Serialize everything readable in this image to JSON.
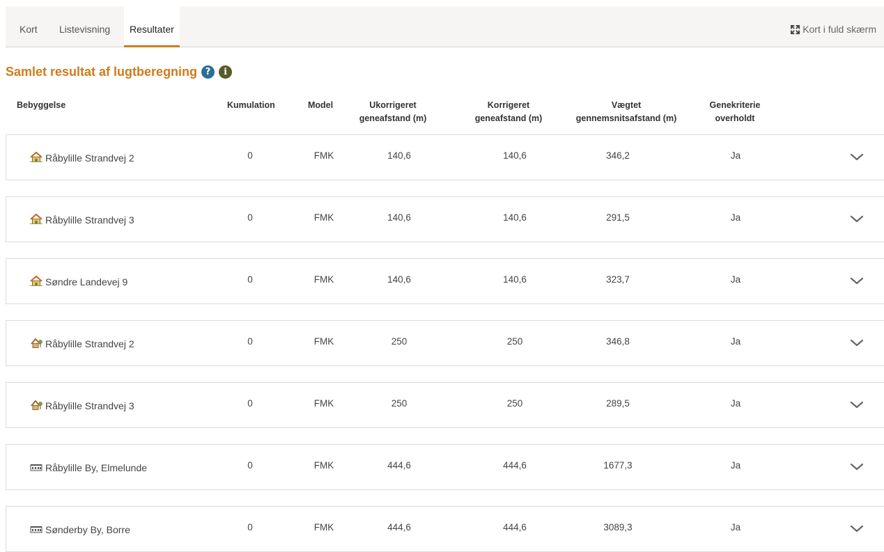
{
  "tabs": [
    {
      "label": "Kort",
      "active": false
    },
    {
      "label": "Listevisning",
      "active": false
    },
    {
      "label": "Resultater",
      "active": true
    }
  ],
  "fullscreen_label": "Kort i fuld skærm",
  "title": "Samlet resultat af lugtberegning",
  "headers": {
    "bebyggelse": "Bebyggelse",
    "kumulation": "Kumulation",
    "model": "Model",
    "ukorrigeret_1": "Ukorrigeret",
    "ukorrigeret_2": "geneafstand (m)",
    "korrigeret_1": "Korrigeret",
    "korrigeret_2": "geneafstand (m)",
    "vaegtet_1": "Vægtet",
    "vaegtet_2": "gennemsnitsafstand (m)",
    "genekriterie_1": "Genekriterie",
    "genekriterie_2": "overholdt"
  },
  "rows": [
    {
      "icon": "single-house-icon",
      "name": "Råbylille Strandvej 2",
      "kumulation": "0",
      "model": "FMK",
      "ukorrigeret": "140,6",
      "korrigeret": "140,6",
      "vaegtet": "346,2",
      "overholdt": "Ja"
    },
    {
      "icon": "single-house-icon",
      "name": "Råbylille Strandvej 3",
      "kumulation": "0",
      "model": "FMK",
      "ukorrigeret": "140,6",
      "korrigeret": "140,6",
      "vaegtet": "291,5",
      "overholdt": "Ja"
    },
    {
      "icon": "single-house-icon",
      "name": "Søndre Landevej 9",
      "kumulation": "0",
      "model": "FMK",
      "ukorrigeret": "140,6",
      "korrigeret": "140,6",
      "vaegtet": "323,7",
      "overholdt": "Ja"
    },
    {
      "icon": "summer-house-icon",
      "name": "Råbylille Strandvej 2",
      "kumulation": "0",
      "model": "FMK",
      "ukorrigeret": "250",
      "korrigeret": "250",
      "vaegtet": "346,8",
      "overholdt": "Ja"
    },
    {
      "icon": "summer-house-icon",
      "name": "Råbylille Strandvej 3",
      "kumulation": "0",
      "model": "FMK",
      "ukorrigeret": "250",
      "korrigeret": "250",
      "vaegtet": "289,5",
      "overholdt": "Ja"
    },
    {
      "icon": "town-icon",
      "name": "Råbylille By, Elmelunde",
      "kumulation": "0",
      "model": "FMK",
      "ukorrigeret": "444,6",
      "korrigeret": "444,6",
      "vaegtet": "1677,3",
      "overholdt": "Ja"
    },
    {
      "icon": "town-icon",
      "name": "Sønderby By, Borre",
      "kumulation": "0",
      "model": "FMK",
      "ukorrigeret": "444,6",
      "korrigeret": "444,6",
      "vaegtet": "3089,3",
      "overholdt": "Ja"
    }
  ]
}
